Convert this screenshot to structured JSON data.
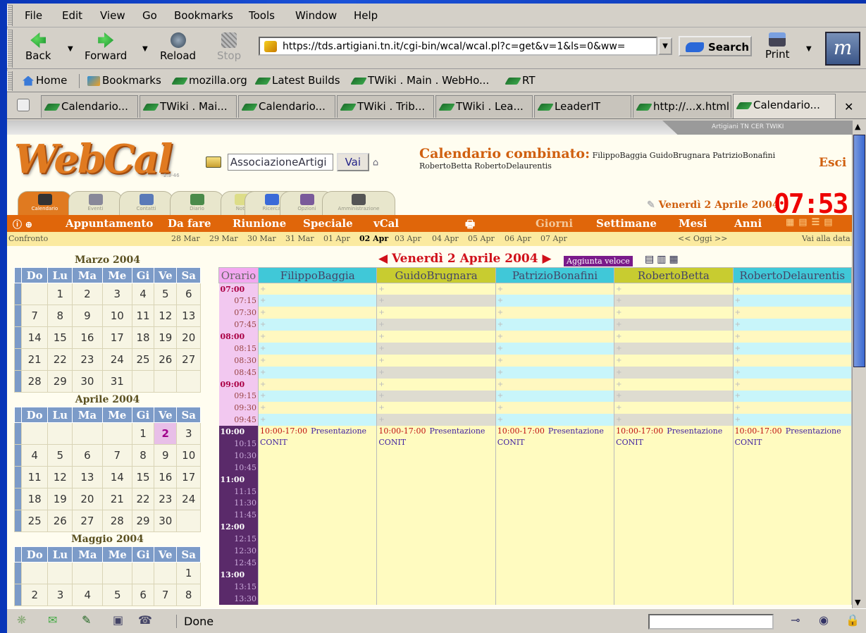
{
  "menu": [
    "File",
    "Edit",
    "View",
    "Go",
    "Bookmarks",
    "Tools",
    "Window",
    "Help"
  ],
  "nav": {
    "back": "Back",
    "forward": "Forward",
    "reload": "Reload",
    "stop": "Stop",
    "url": "https://tds.artigiani.tn.it/cgi-bin/wcal/wcal.pl?c=get&v=1&ls=0&ww=",
    "search": "Search",
    "print": "Print"
  },
  "personal": [
    "Home",
    "Bookmarks",
    "mozilla.org",
    "Latest Builds",
    "TWiki . Main . WebHo...",
    "RT"
  ],
  "tabs": [
    "Calendario...",
    "TWiki . Mai...",
    "Calendario...",
    "TWiki . Trib...",
    "TWiki . Lea...",
    "LeaderIT",
    "http://...x.html",
    "Calendario..."
  ],
  "status": {
    "text": "Done"
  },
  "webcal": {
    "logo": "WebCal",
    "version": "2.3-46",
    "topstrip": "Artigiani TN   CER   TWIKI",
    "assoc_value": "AssociazioneArtigi",
    "vai": "Vai",
    "title": "Calendario combinato:",
    "people_line1": "FilippoBaggia GuidoBrugnara PatrizioBonafini",
    "people_line2": "RobertoBetta RobertoDelaurentis",
    "esci": "Esci",
    "icon_tabs": [
      "Calendario",
      "Eventi",
      "Contatti",
      "Diario",
      "Note",
      "Ricerca",
      "Opzioni",
      "Amministrazione"
    ],
    "date": "Venerdì 2 Aprile 2004",
    "clock": "07:53",
    "orange": [
      "Appuntamento",
      "Da fare",
      "Riunione",
      "Speciale",
      "vCal",
      "Giorni",
      "Settimane",
      "Mesi",
      "Anni"
    ],
    "confronto": "Confronto",
    "days": [
      "28 Mar",
      "29 Mar",
      "30 Mar",
      "31 Mar",
      "01 Apr",
      "02 Apr",
      "03 Apr",
      "04 Apr",
      "05 Apr",
      "06 Apr",
      "07 Apr"
    ],
    "oggi": "<< Oggi >>",
    "vai_data": "Vai alla data",
    "day_header": "Venerdì 2 Aprile 2004",
    "aggiunta": "Aggiunta veloce",
    "orario": "Orario",
    "people": [
      "FilippoBaggia",
      "GuidoBrugnara",
      "PatrizioBonafini",
      "RobertoBetta",
      "RobertoDelaurentis"
    ],
    "event_time": "10:00-17:00",
    "event_title": "Presentazione",
    "event_sub": "CONIT",
    "times": [
      "07:00",
      "07:15",
      "07:30",
      "07:45",
      "08:00",
      "08:15",
      "08:30",
      "08:45",
      "09:00",
      "09:15",
      "09:30",
      "09:45",
      "10:00",
      "10:15",
      "10:30",
      "10:45",
      "11:00",
      "11:15",
      "11:30",
      "11:45",
      "12:00",
      "12:15",
      "12:30",
      "12:45",
      "13:00",
      "13:15",
      "13:30"
    ],
    "weekdays": [
      "Do",
      "Lu",
      "Ma",
      "Me",
      "Gi",
      "Ve",
      "Sa"
    ],
    "months": [
      {
        "name": "Marzo 2004",
        "rows": [
          [
            "",
            1,
            2,
            3,
            4,
            5,
            6
          ],
          [
            7,
            8,
            9,
            10,
            11,
            12,
            13
          ],
          [
            14,
            15,
            16,
            17,
            18,
            19,
            20
          ],
          [
            21,
            22,
            23,
            24,
            25,
            26,
            27
          ],
          [
            28,
            29,
            30,
            31,
            "",
            "",
            ""
          ]
        ]
      },
      {
        "name": "Aprile 2004",
        "rows": [
          [
            "",
            "",
            "",
            "",
            1,
            2,
            3
          ],
          [
            4,
            5,
            6,
            7,
            8,
            9,
            10
          ],
          [
            11,
            12,
            13,
            14,
            15,
            16,
            17
          ],
          [
            18,
            19,
            20,
            21,
            22,
            23,
            24
          ],
          [
            25,
            26,
            27,
            28,
            29,
            30,
            ""
          ]
        ],
        "today": 2
      },
      {
        "name": "Maggio 2004",
        "rows": [
          [
            "",
            "",
            "",
            "",
            "",
            "",
            1
          ],
          [
            2,
            3,
            4,
            5,
            6,
            7,
            8
          ]
        ]
      }
    ]
  }
}
